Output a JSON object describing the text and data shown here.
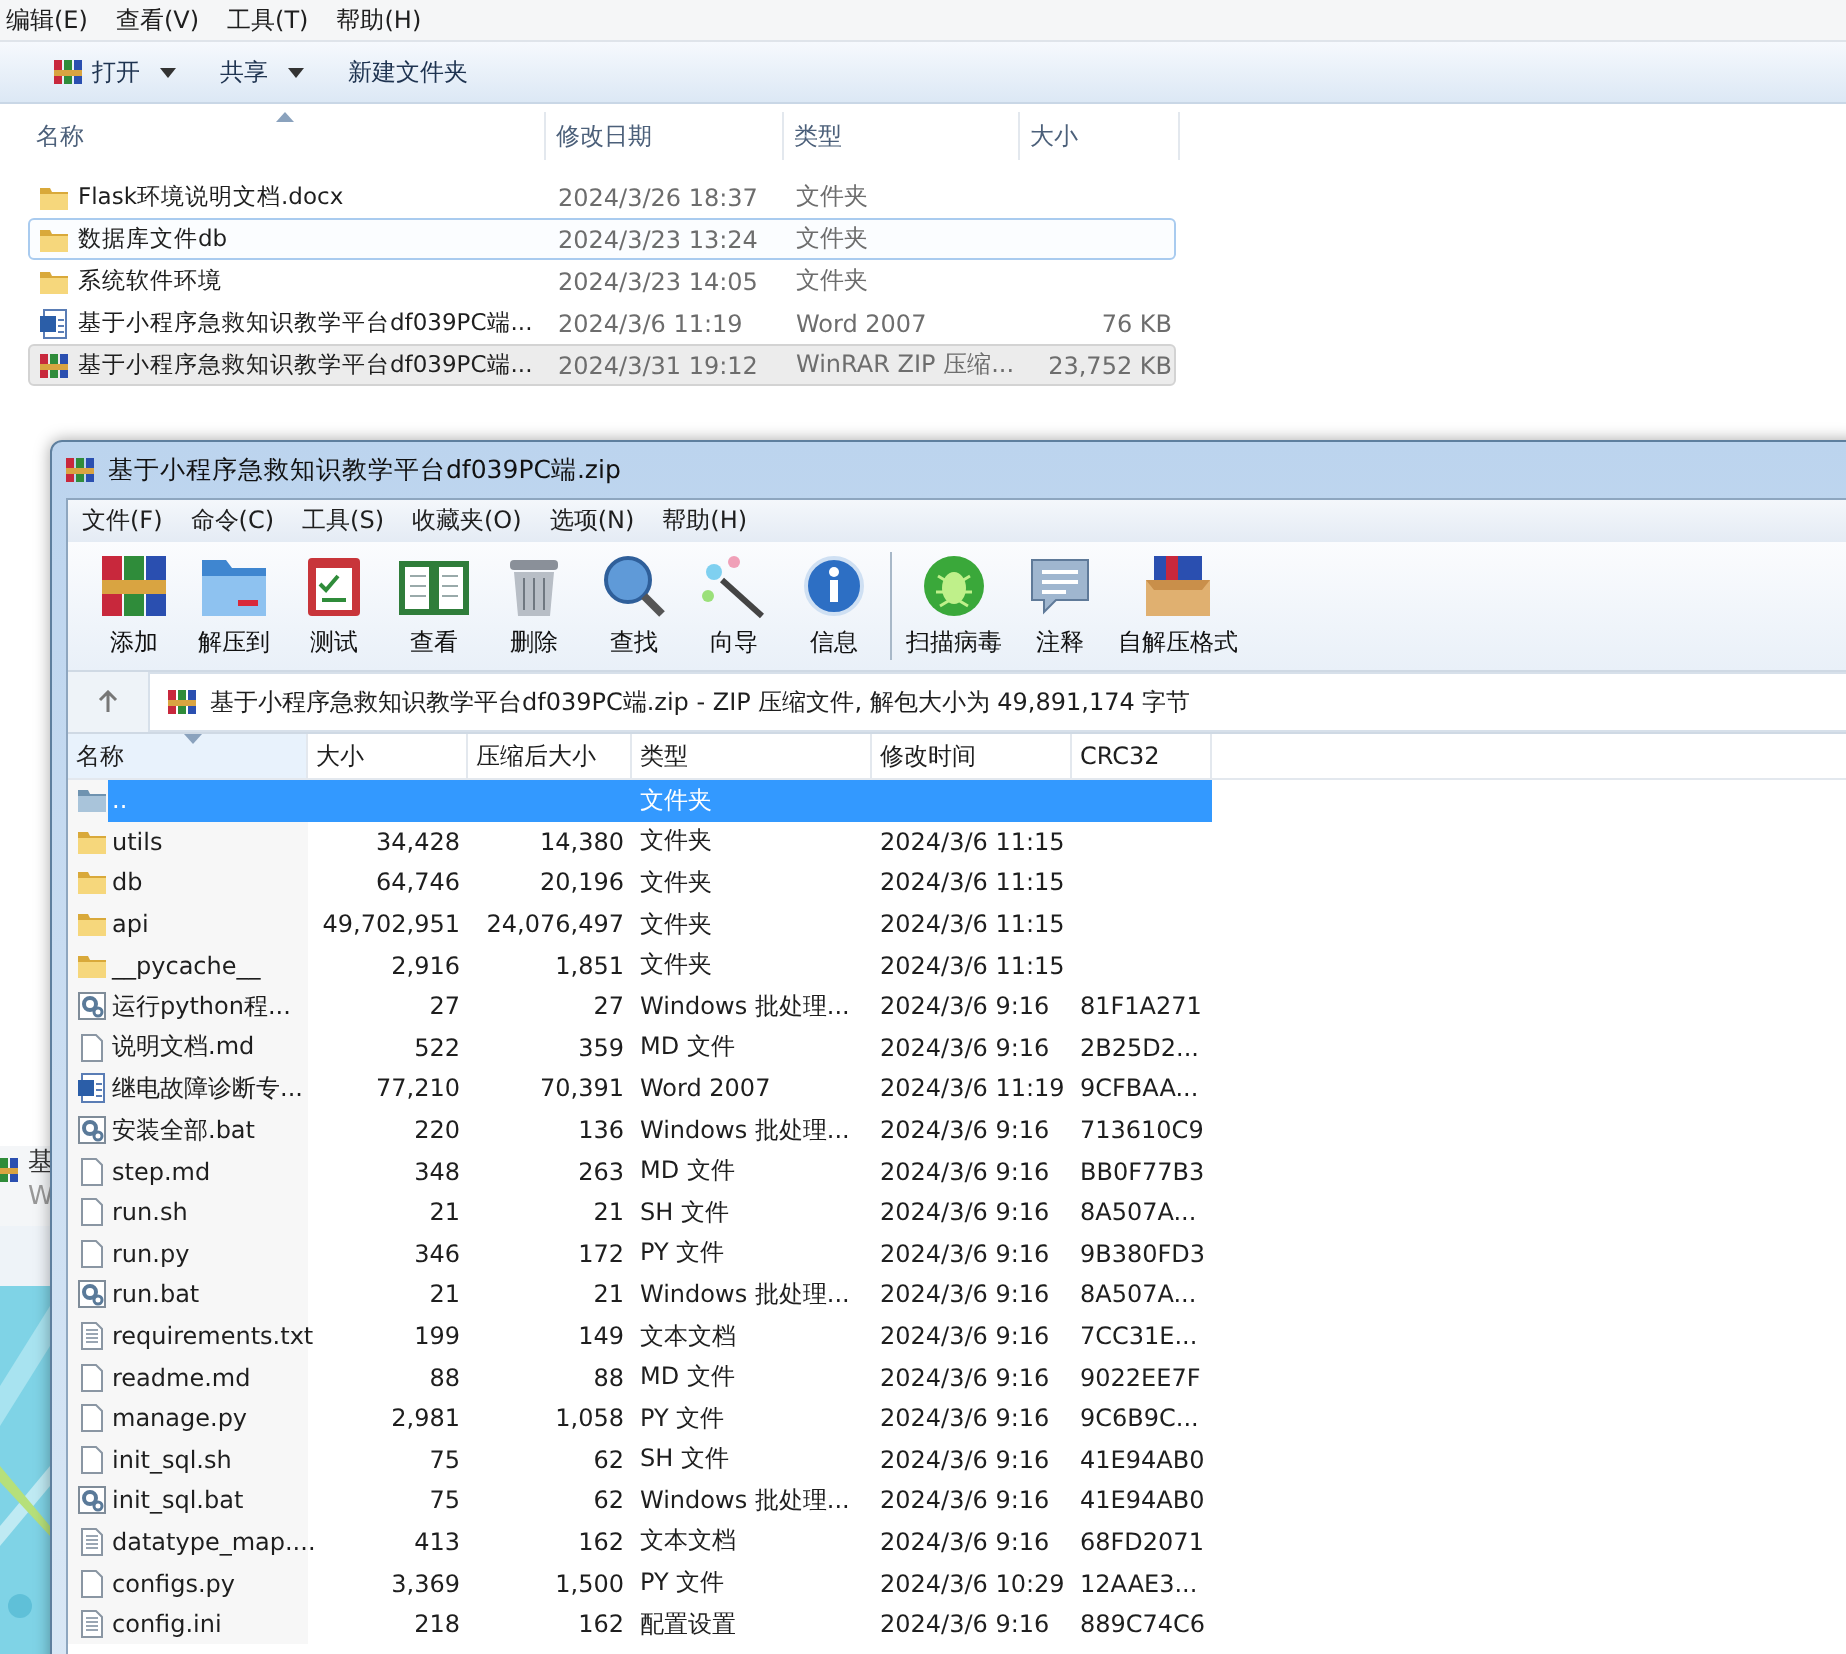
{
  "explorer": {
    "menu": [
      "编辑(E)",
      "查看(V)",
      "工具(T)",
      "帮助(H)"
    ],
    "toolbar": [
      {
        "label": "打开",
        "kind": "rar",
        "dropdown": true
      },
      {
        "label": "共享",
        "kind": "none",
        "dropdown": true
      },
      {
        "label": "新建文件夹",
        "kind": "none",
        "dropdown": false
      }
    ],
    "columns": [
      "名称",
      "修改日期",
      "类型",
      "大小"
    ],
    "rows": [
      {
        "name": "Flask环境说明文档.docx",
        "date": "2024/3/26 18:37",
        "type": "文件夹",
        "size": "",
        "kind": "folder",
        "selected": false,
        "focused": false
      },
      {
        "name": "数据库文件db",
        "date": "2024/3/23 13:24",
        "type": "文件夹",
        "size": "",
        "kind": "folder",
        "selected": false,
        "focused": true
      },
      {
        "name": "系统软件环境",
        "date": "2024/3/23 14:05",
        "type": "文件夹",
        "size": "",
        "kind": "folder",
        "selected": false,
        "focused": false
      },
      {
        "name": "基于小程序急救知识教学平台df039PC端...",
        "date": "2024/3/6 11:19",
        "type": "Word 2007",
        "size": "76 KB",
        "kind": "word",
        "selected": false,
        "focused": false
      },
      {
        "name": "基于小程序急救知识教学平台df039PC端...",
        "date": "2024/3/31 19:12",
        "type": "WinRAR ZIP 压缩...",
        "size": "23,752 KB",
        "kind": "rar",
        "selected": true,
        "focused": false
      }
    ]
  },
  "background_window": {
    "texts": [
      "基",
      "W"
    ]
  },
  "winrar": {
    "title": "基于小程序急救知识教学平台df039PC端.zip",
    "menu": [
      "文件(F)",
      "命令(C)",
      "工具(S)",
      "收藏夹(O)",
      "选项(N)",
      "帮助(H)"
    ],
    "toolbar": [
      {
        "label": "添加",
        "kind": "add"
      },
      {
        "label": "解压到",
        "kind": "extract"
      },
      {
        "label": "测试",
        "kind": "test"
      },
      {
        "label": "查看",
        "kind": "view"
      },
      {
        "label": "删除",
        "kind": "delete"
      },
      {
        "label": "查找",
        "kind": "find"
      },
      {
        "label": "向导",
        "kind": "wizard"
      },
      {
        "label": "信息",
        "kind": "info"
      },
      {
        "label": "扫描病毒",
        "kind": "scan"
      },
      {
        "label": "注释",
        "kind": "comment"
      },
      {
        "label": "自解压格式",
        "kind": "sfx"
      }
    ],
    "address": "基于小程序急救知识教学平台df039PC端.zip - ZIP 压缩文件, 解包大小为 49,891,174 字节",
    "columns": [
      "名称",
      "大小",
      "压缩后大小",
      "类型",
      "修改时间",
      "CRC32"
    ],
    "rows": [
      {
        "name": "..",
        "size": "",
        "packed": "",
        "type": "文件夹",
        "mtime": "",
        "crc": "",
        "kind": "up",
        "selected": true
      },
      {
        "name": "utils",
        "size": "34,428",
        "packed": "14,380",
        "type": "文件夹",
        "mtime": "2024/3/6 11:15",
        "crc": "",
        "kind": "folder",
        "selected": false
      },
      {
        "name": "db",
        "size": "64,746",
        "packed": "20,196",
        "type": "文件夹",
        "mtime": "2024/3/6 11:15",
        "crc": "",
        "kind": "folder",
        "selected": false
      },
      {
        "name": "api",
        "size": "49,702,951",
        "packed": "24,076,497",
        "type": "文件夹",
        "mtime": "2024/3/6 11:15",
        "crc": "",
        "kind": "folder",
        "selected": false
      },
      {
        "name": "__pycache__",
        "size": "2,916",
        "packed": "1,851",
        "type": "文件夹",
        "mtime": "2024/3/6 11:15",
        "crc": "",
        "kind": "folder",
        "selected": false
      },
      {
        "name": "运行python程...",
        "size": "27",
        "packed": "27",
        "type": "Windows 批处理...",
        "mtime": "2024/3/6 9:16",
        "crc": "81F1A271",
        "kind": "bat",
        "selected": false
      },
      {
        "name": "说明文档.md",
        "size": "522",
        "packed": "359",
        "type": "MD 文件",
        "mtime": "2024/3/6 9:16",
        "crc": "2B25D2...",
        "kind": "file",
        "selected": false
      },
      {
        "name": "继电故障诊断专...",
        "size": "77,210",
        "packed": "70,391",
        "type": "Word 2007",
        "mtime": "2024/3/6 11:19",
        "crc": "9CFBAA...",
        "kind": "word",
        "selected": false
      },
      {
        "name": "安装全部.bat",
        "size": "220",
        "packed": "136",
        "type": "Windows 批处理...",
        "mtime": "2024/3/6 9:16",
        "crc": "713610C9",
        "kind": "bat",
        "selected": false
      },
      {
        "name": "step.md",
        "size": "348",
        "packed": "263",
        "type": "MD 文件",
        "mtime": "2024/3/6 9:16",
        "crc": "BB0F77B3",
        "kind": "file",
        "selected": false
      },
      {
        "name": "run.sh",
        "size": "21",
        "packed": "21",
        "type": "SH 文件",
        "mtime": "2024/3/6 9:16",
        "crc": "8A507A...",
        "kind": "file",
        "selected": false
      },
      {
        "name": "run.py",
        "size": "346",
        "packed": "172",
        "type": "PY 文件",
        "mtime": "2024/3/6 9:16",
        "crc": "9B380FD3",
        "kind": "file",
        "selected": false
      },
      {
        "name": "run.bat",
        "size": "21",
        "packed": "21",
        "type": "Windows 批处理...",
        "mtime": "2024/3/6 9:16",
        "crc": "8A507A...",
        "kind": "bat",
        "selected": false
      },
      {
        "name": "requirements.txt",
        "size": "199",
        "packed": "149",
        "type": "文本文档",
        "mtime": "2024/3/6 9:16",
        "crc": "7CC31E...",
        "kind": "text",
        "selected": false
      },
      {
        "name": "readme.md",
        "size": "88",
        "packed": "88",
        "type": "MD 文件",
        "mtime": "2024/3/6 9:16",
        "crc": "9022EE7F",
        "kind": "file",
        "selected": false
      },
      {
        "name": "manage.py",
        "size": "2,981",
        "packed": "1,058",
        "type": "PY 文件",
        "mtime": "2024/3/6 9:16",
        "crc": "9C6B9C...",
        "kind": "file",
        "selected": false
      },
      {
        "name": "init_sql.sh",
        "size": "75",
        "packed": "62",
        "type": "SH 文件",
        "mtime": "2024/3/6 9:16",
        "crc": "41E94AB0",
        "kind": "file",
        "selected": false
      },
      {
        "name": "init_sql.bat",
        "size": "75",
        "packed": "62",
        "type": "Windows 批处理...",
        "mtime": "2024/3/6 9:16",
        "crc": "41E94AB0",
        "kind": "bat",
        "selected": false
      },
      {
        "name": "datatype_map....",
        "size": "413",
        "packed": "162",
        "type": "文本文档",
        "mtime": "2024/3/6 9:16",
        "crc": "68FD2071",
        "kind": "text",
        "selected": false
      },
      {
        "name": "configs.py",
        "size": "3,369",
        "packed": "1,500",
        "type": "PY 文件",
        "mtime": "2024/3/6 10:29",
        "crc": "12AAE3...",
        "kind": "file",
        "selected": false
      },
      {
        "name": "config.ini",
        "size": "218",
        "packed": "162",
        "type": "配置设置",
        "mtime": "2024/3/6 9:16",
        "crc": "889C74C6",
        "kind": "text",
        "selected": false
      }
    ]
  }
}
